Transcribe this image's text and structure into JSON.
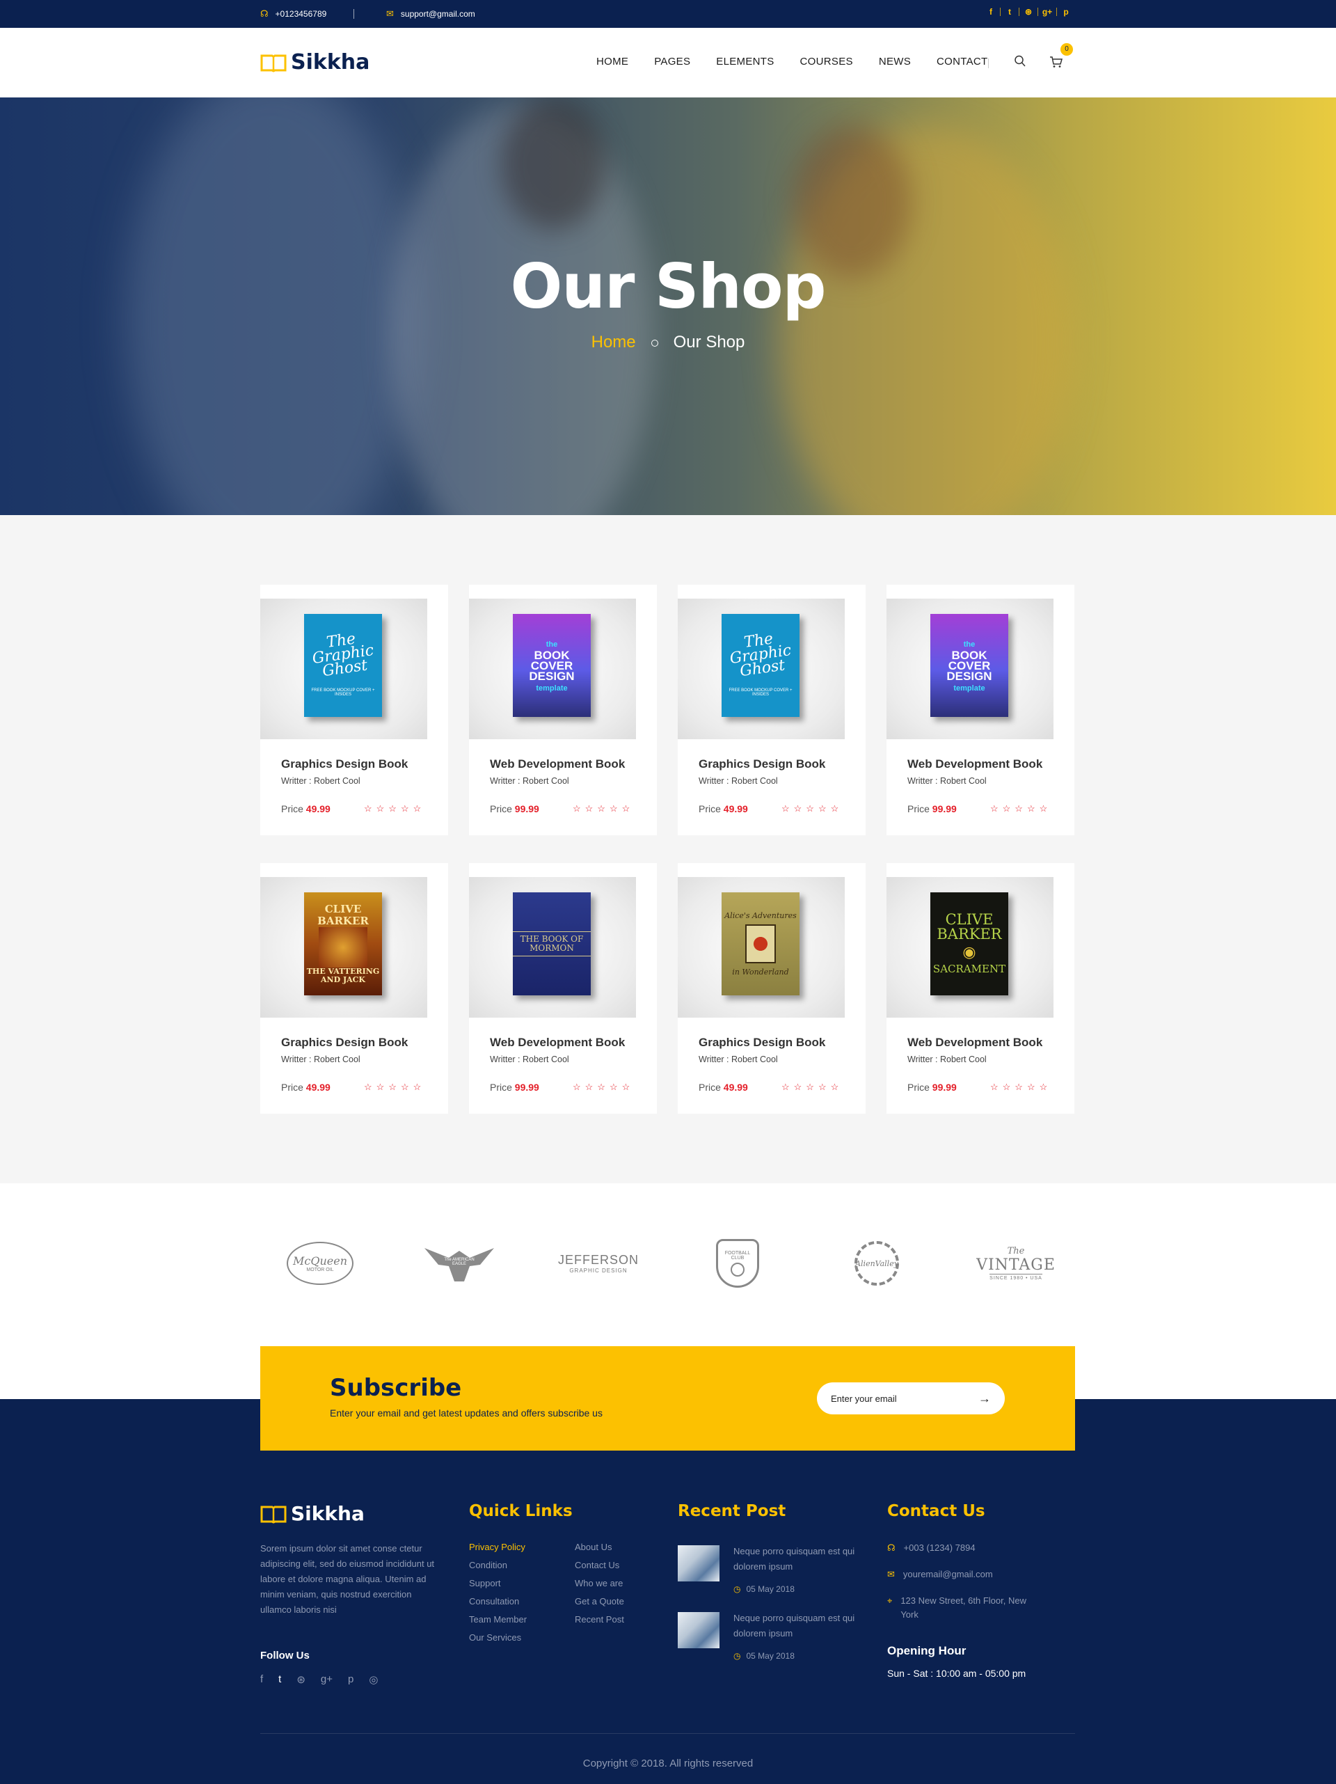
{
  "topbar": {
    "phone": "+0123456789",
    "email": "support@gmail.com",
    "social_icons": [
      "facebook-icon",
      "twitter-icon",
      "dribbble-icon",
      "google-plus-icon",
      "pinterest-icon"
    ],
    "social_glyphs": [
      "f",
      "t",
      "⊛",
      "g+",
      "p"
    ]
  },
  "header": {
    "logo": "Sikkha",
    "nav": [
      "HOME",
      "PAGES",
      "ELEMENTS",
      "COURSES",
      "NEWS",
      "CONTACT"
    ],
    "cart_count": "0"
  },
  "hero": {
    "title": "Our Shop",
    "crumb_home": "Home",
    "crumb_current": "Our Shop"
  },
  "products": [
    {
      "title": "Graphics Design Book",
      "writer": "Writter : Robert Cool",
      "price_label": "Price",
      "price": "49.99",
      "cover": "ghost",
      "rating": 0
    },
    {
      "title": "Web Development Book",
      "writer": "Writter : Robert Cool",
      "price_label": "Price",
      "price": "99.99",
      "cover": "cover",
      "rating": 0
    },
    {
      "title": "Graphics Design Book",
      "writer": "Writter : Robert Cool",
      "price_label": "Price",
      "price": "49.99",
      "cover": "ghost",
      "rating": 0
    },
    {
      "title": "Web Development Book",
      "writer": "Writter : Robert Cool",
      "price_label": "Price",
      "price": "99.99",
      "cover": "cover",
      "rating": 0
    },
    {
      "title": "Graphics Design Book",
      "writer": "Writter : Robert Cool",
      "price_label": "Price",
      "price": "49.99",
      "cover": "clive1",
      "rating": 0
    },
    {
      "title": "Web Development Book",
      "writer": "Writter : Robert Cool",
      "price_label": "Price",
      "price": "99.99",
      "cover": "mormon",
      "rating": 0
    },
    {
      "title": "Graphics Design Book",
      "writer": "Writter : Robert Cool",
      "price_label": "Price",
      "price": "49.99",
      "cover": "alice",
      "rating": 0
    },
    {
      "title": "Web Development Book",
      "writer": "Writter : Robert Cool",
      "price_label": "Price",
      "price": "99.99",
      "cover": "clive2",
      "rating": 0
    }
  ],
  "book_covers": {
    "ghost": {
      "title": "The Graphic Ghost",
      "subtitle": "FREE BOOK MOCKUP COVER + INSIDES"
    },
    "cover": {
      "pre": "the",
      "title": "BOOK COVER DESIGN",
      "post": "template"
    },
    "clive1": {
      "title": "CLIVE BARKER",
      "subtitle": "THE VATTERING AND JACK"
    },
    "mormon": {
      "title": "THE BOOK OF MORMON"
    },
    "alice": {
      "title": "Alice's Adventures",
      "subtitle": "in Wonderland"
    },
    "clive2": {
      "title": "CLIVE BARKER",
      "subtitle": "SACRAMENT"
    }
  },
  "brands": [
    {
      "name": "mcqueen-logo",
      "text": "McQueen",
      "sub": "MOTOR OIL"
    },
    {
      "name": "american-eagle-logo",
      "text": "The AMERICAN EAGLE",
      "sub": ""
    },
    {
      "name": "jefferson-logo",
      "text": "JEFFERSON",
      "sub": "GRAPHIC DESIGN"
    },
    {
      "name": "football-club-logo",
      "text": "FOOTBALL CLUB",
      "sub": ""
    },
    {
      "name": "alien-valley-logo",
      "text": "AlienValley",
      "sub": ""
    },
    {
      "name": "vintage-logo",
      "text": "VINTAGE",
      "sub": "SINCE 1980 • USA"
    }
  ],
  "subscribe": {
    "heading": "Subscribe",
    "text": "Enter  your email and get latest updates and offers subscribe us",
    "placeholder": "Enter your email",
    "arrow": "→"
  },
  "footer": {
    "logo": "Sikkha",
    "about": "Sorem ipsum dolor sit amet conse ctetur adipiscing elit, sed do eiusmod  incididunt ut labore et dolore magna aliqua. Utenim ad minim veniam, quis nostrud exercition ullamco laboris nisi",
    "follow_us": "Follow Us",
    "follow_icons": [
      "f",
      "t",
      "⊛",
      "g+",
      "p",
      "◎"
    ],
    "quick_links_title": "Quick Links",
    "links_col1": [
      "Privacy Policy",
      "Condition",
      "Support",
      "Consultation",
      "Team Member",
      "Our Services"
    ],
    "links_col2": [
      "About Us",
      "Contact Us",
      "Who we are",
      "Get a Quote",
      "Recent Post"
    ],
    "recent_post_title": "Recent Post",
    "posts": [
      {
        "text": "Neque porro quisquam est qui dolorem ipsum",
        "date": "05 May 2018"
      },
      {
        "text": "Neque porro quisquam est qui dolorem ipsum",
        "date": "05 May 2018"
      }
    ],
    "contact_title": "Contact Us",
    "phone": "+003 (1234) 7894",
    "email": "youremail@gmail.com",
    "address": "123 New Street, 6th Floor, New York",
    "opening_title": "Opening Hour",
    "opening_hours": "Sun - Sat : 10:00 am - 05:00 pm",
    "copyright": "Copyright © 2018. All rights reserved"
  },
  "colors": {
    "navy": "#0b2150",
    "yellow": "#fcc101",
    "red": "#e4202a"
  }
}
